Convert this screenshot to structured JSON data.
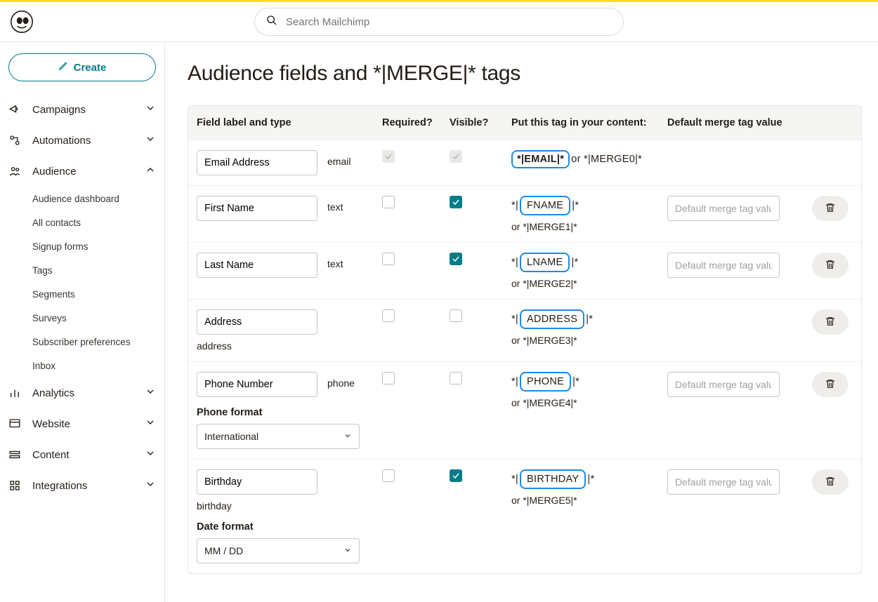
{
  "search": {
    "placeholder": "Search Mailchimp"
  },
  "sidebar": {
    "create_label": "Create",
    "items": [
      {
        "id": "campaigns",
        "label": "Campaigns",
        "expanded": false
      },
      {
        "id": "automations",
        "label": "Automations",
        "expanded": false
      },
      {
        "id": "audience",
        "label": "Audience",
        "expanded": true,
        "children": [
          {
            "id": "audience-dashboard",
            "label": "Audience dashboard"
          },
          {
            "id": "all-contacts",
            "label": "All contacts"
          },
          {
            "id": "signup-forms",
            "label": "Signup forms"
          },
          {
            "id": "tags",
            "label": "Tags"
          },
          {
            "id": "segments",
            "label": "Segments"
          },
          {
            "id": "surveys",
            "label": "Surveys"
          },
          {
            "id": "subscriber-preferences",
            "label": "Subscriber preferences"
          },
          {
            "id": "inbox",
            "label": "Inbox"
          }
        ]
      },
      {
        "id": "analytics",
        "label": "Analytics",
        "expanded": false
      },
      {
        "id": "website",
        "label": "Website",
        "expanded": false
      },
      {
        "id": "content",
        "label": "Content",
        "expanded": false
      },
      {
        "id": "integrations",
        "label": "Integrations",
        "expanded": false
      }
    ]
  },
  "page": {
    "title": "Audience fields and *|MERGE|* tags"
  },
  "table": {
    "headers": {
      "label": "Field label and type",
      "required": "Required?",
      "visible": "Visible?",
      "tag": "Put this tag in your content:",
      "default": "Default merge tag value"
    },
    "default_placeholder": "Default merge tag value",
    "rows": [
      {
        "id": "email",
        "label": "Email Address",
        "type": "email",
        "required": "locked",
        "visible": "locked",
        "tag_full": "*|EMAIL|*",
        "alt_inline": " or *|MERGE0|*",
        "has_default": false,
        "deletable": false
      },
      {
        "id": "fname",
        "label": "First Name",
        "type": "text",
        "required": false,
        "visible": true,
        "tag_value": "FNAME",
        "alt": "or *|MERGE1|*",
        "has_default": true,
        "deletable": true
      },
      {
        "id": "lname",
        "label": "Last Name",
        "type": "text",
        "required": false,
        "visible": true,
        "tag_value": "LNAME",
        "alt": "or *|MERGE2|*",
        "has_default": true,
        "deletable": true
      },
      {
        "id": "address",
        "label": "Address",
        "type": "address",
        "show_type_below": true,
        "required": false,
        "visible": false,
        "tag_value": "ADDRESS",
        "alt": "or *|MERGE3|*",
        "has_default": false,
        "deletable": true
      },
      {
        "id": "phone",
        "label": "Phone Number",
        "type": "phone",
        "required": false,
        "visible": false,
        "tag_value": "PHONE",
        "alt": "or *|MERGE4|*",
        "has_default": true,
        "deletable": true,
        "extra_select": {
          "heading": "Phone format",
          "value": "International"
        }
      },
      {
        "id": "birthday",
        "label": "Birthday",
        "type": "birthday",
        "show_type_below": true,
        "required": false,
        "visible": true,
        "tag_value": "BIRTHDAY",
        "alt": "or *|MERGE5|*",
        "has_default": true,
        "deletable": true,
        "extra_select": {
          "heading": "Date format",
          "value": "MM / DD"
        }
      }
    ]
  }
}
